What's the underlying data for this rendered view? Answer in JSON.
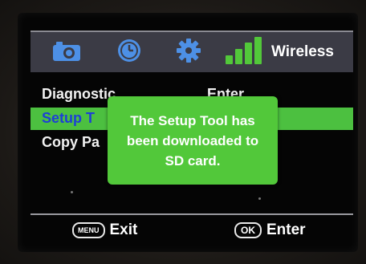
{
  "tabs": {
    "camera_icon": "camera-icon",
    "clock_icon": "clock-icon",
    "gear_icon": "gear-icon",
    "signal_icon": "signal-bars-icon",
    "wireless_label": "Wireless"
  },
  "menu": {
    "items": [
      {
        "label": "Diagnostic",
        "value": "Enter"
      },
      {
        "label": "Setup T",
        "value": ""
      },
      {
        "label": "Copy Pa",
        "value": ""
      }
    ]
  },
  "popup": {
    "message": "The Setup Tool has\nbeen downloaded to\nSD card."
  },
  "footer": {
    "exit_key": "MENU",
    "exit_label": "Exit",
    "enter_key": "OK",
    "enter_label": "Enter"
  },
  "colors": {
    "accent_green": "#52c83a",
    "selected_text_blue": "#1d3fd6",
    "tabbar_bg": "#3b3b45"
  }
}
